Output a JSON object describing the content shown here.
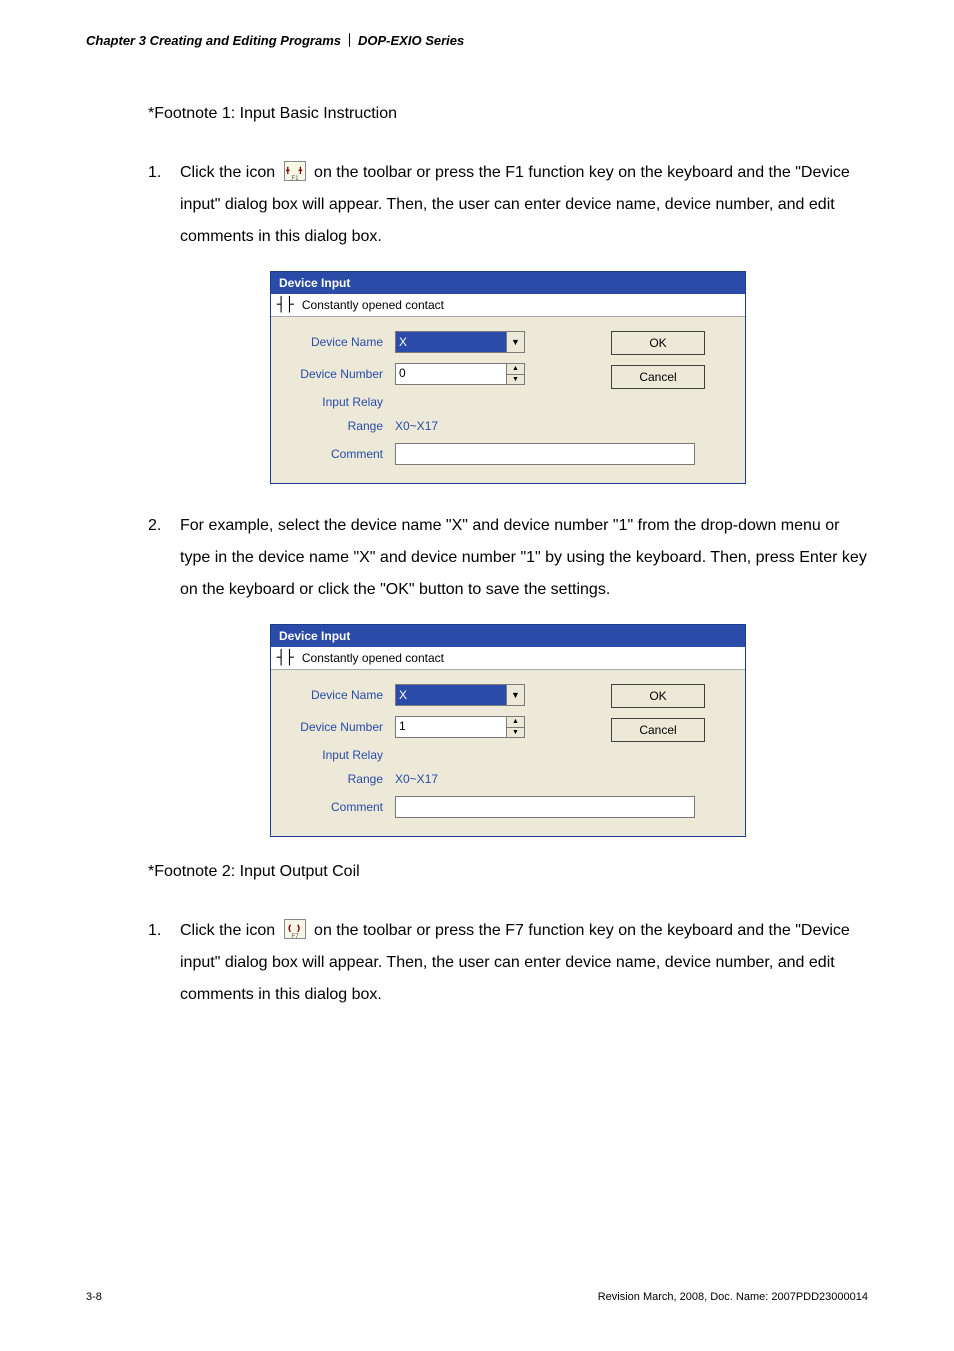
{
  "header": {
    "chapter": "Chapter 3 Creating and Editing Programs",
    "separator": "｜",
    "series": "DOP-EXIO Series"
  },
  "footnote1": {
    "title": "*Footnote 1: Input Basic Instruction",
    "items": {
      "1": {
        "num": "1.",
        "pre": "Click the icon ",
        "post": " on the toolbar or press the F1 function key on the keyboard and the \"Device input\" dialog box will appear. Then, the user can enter device name, device number, and edit comments in this dialog box."
      },
      "2": {
        "num": "2.",
        "text": "For example, select the device name \"X\" and device number \"1\" from the drop-down menu or type in the device name \"X\" and device number \"1\" by using the keyboard. Then, press Enter key on the keyboard or click the \"OK\" button to save the settings."
      }
    }
  },
  "footnote2": {
    "title": "*Footnote 2: Input Output Coil",
    "items": {
      "1": {
        "num": "1.",
        "pre": "Click the icon ",
        "post": " on the toolbar or press the F7 function key on the keyboard and the \"Device input\" dialog box will appear. Then, the user can enter device name, device number, and edit comments in this dialog box."
      }
    }
  },
  "dialog1": {
    "title": "Device Input",
    "subtitle": "Constantly opened contact",
    "labels": {
      "deviceName": "Device Name",
      "deviceNumber": "Device Number",
      "inputRelay": "Input Relay",
      "range": "Range",
      "comment": "Comment"
    },
    "deviceNameValue": "X",
    "deviceNumberValue": "0",
    "rangeValue": "X0~X17",
    "commentValue": "",
    "buttons": {
      "ok": "OK",
      "cancel": "Cancel"
    }
  },
  "dialog2": {
    "title": "Device Input",
    "subtitle": "Constantly opened contact",
    "labels": {
      "deviceName": "Device Name",
      "deviceNumber": "Device Number",
      "inputRelay": "Input Relay",
      "range": "Range",
      "comment": "Comment"
    },
    "deviceNameValue": "X",
    "deviceNumberValue": "1",
    "rangeValue": "X0~X17",
    "commentValue": "",
    "buttons": {
      "ok": "OK",
      "cancel": "Cancel"
    }
  },
  "icons": {
    "f1_label": "F1",
    "f7_label": "F7"
  },
  "footer": {
    "page": "3-8",
    "revision": "Revision March, 2008, Doc. Name: 2007PDD23000014"
  }
}
